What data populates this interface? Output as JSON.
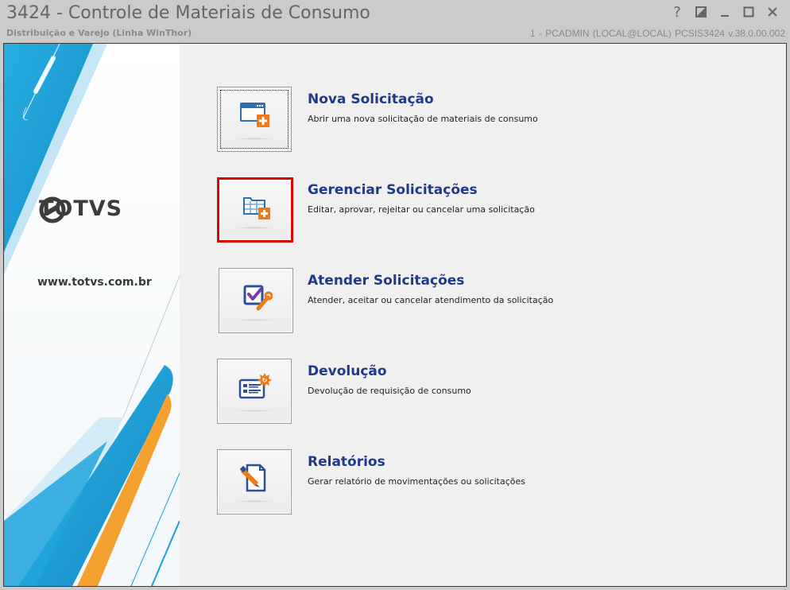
{
  "window": {
    "title": "3424 - Controle de Materiais de Consumo",
    "subtitle": "Distribuição e Varejo (Linha WinThor)",
    "session_info": "1 - PCADMIN (LOCAL@LOCAL)  PCSIS3424  v.38.0.00.002",
    "controls": {
      "help": "?",
      "restore_icon": "restore-icon",
      "minimize_icon": "minimize-icon",
      "maximize_icon": "maximize-icon",
      "close_icon": "close-icon"
    }
  },
  "sidebar": {
    "logo_text": "TOTVS",
    "website": "www.totvs.com.br",
    "colors": {
      "blue": "#1aa0d8",
      "orange": "#f5a130"
    }
  },
  "menu": {
    "items": [
      {
        "title": "Nova Solicitação",
        "description": "Abrir uma nova solicitação de materiais de consumo",
        "icon": "new-request-icon",
        "focused": true,
        "highlighted": false
      },
      {
        "title": "Gerenciar Solicitações",
        "description": "Editar, aprovar, rejeitar ou cancelar uma solicitação",
        "icon": "manage-requests-icon",
        "focused": false,
        "highlighted": true
      },
      {
        "title": "Atender Solicitações",
        "description": "Atender, aceitar ou cancelar atendimento da solicitação",
        "icon": "fulfill-requests-icon",
        "focused": false,
        "highlighted": false
      },
      {
        "title": "Devolução",
        "description": "Devolução de requisição de consumo",
        "icon": "return-icon",
        "focused": false,
        "highlighted": false
      },
      {
        "title": "Relatórios",
        "description": "Gerar relatório de movimentações ou solicitações",
        "icon": "reports-icon",
        "focused": false,
        "highlighted": false
      }
    ],
    "highlight_color": "#e00000",
    "title_color": "#1f3a8a"
  }
}
